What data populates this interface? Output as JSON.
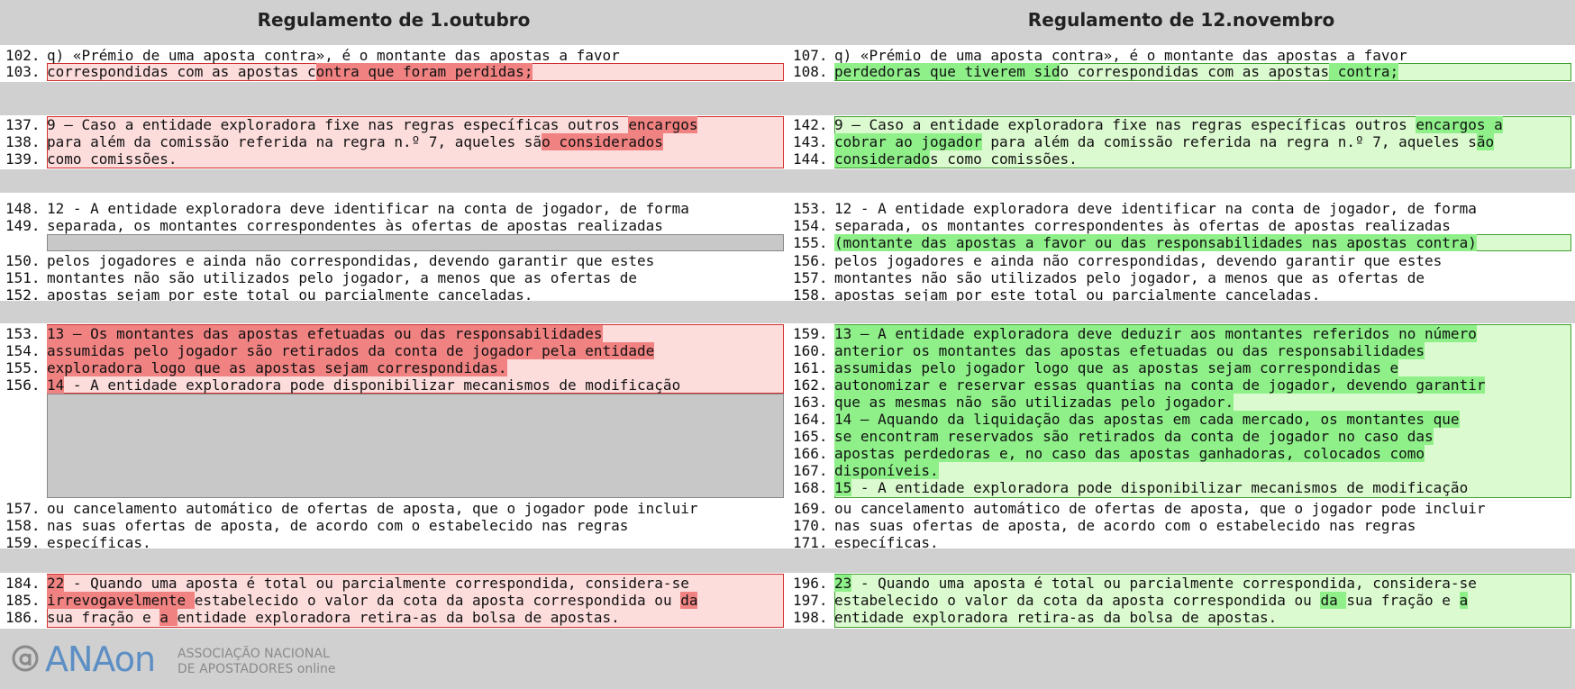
{
  "header": {
    "left_title": "Regulamento de 1.outubro",
    "right_title": "Regulamento de 12.novembro"
  },
  "hunks": [
    {
      "left": [
        {
          "n": "102.",
          "t": "q) «Prémio de uma aposta contra», é o montante das apostas a favor"
        },
        {
          "n": "103.",
          "t": "correspondidas com as apostas contra que foram perdidas;"
        }
      ],
      "right": [
        {
          "n": "107.",
          "t": "q) «Prémio de uma aposta contra», é o montante das apostas a favor"
        },
        {
          "n": "108.",
          "t": "perdedoras que tiverem sido correspondidas com as apostas contra;"
        }
      ]
    },
    {
      "left": [
        {
          "n": "137.",
          "t": "9 – Caso a entidade exploradora fixe nas regras específicas outros encargos"
        },
        {
          "n": "138.",
          "t": "para além da comissão referida na regra n.º 7, aqueles são considerados"
        },
        {
          "n": "139.",
          "t": "como comissões."
        }
      ],
      "right": [
        {
          "n": "142.",
          "t": "9 – Caso a entidade exploradora fixe nas regras específicas outros encargos a"
        },
        {
          "n": "143.",
          "t": "cobrar ao jogador para além da comissão referida na regra n.º 7, aqueles são"
        },
        {
          "n": "144.",
          "t": "considerados como comissões."
        }
      ]
    },
    {
      "left": [
        {
          "n": "148.",
          "t": "12 - A entidade exploradora deve identificar na conta de jogador, de forma"
        },
        {
          "n": "149.",
          "t": "separada, os montantes correspondentes às ofertas de apostas realizadas"
        },
        {
          "n": "150.",
          "t": "pelos jogadores e ainda não correspondidas, devendo garantir que estes"
        },
        {
          "n": "151.",
          "t": "montantes não são utilizados pelo jogador, a menos que as ofertas de"
        },
        {
          "n": "152.",
          "t": "apostas sejam por este total ou parcialmente canceladas."
        }
      ],
      "right": [
        {
          "n": "153.",
          "t": "12 - A entidade exploradora deve identificar na conta de jogador, de forma"
        },
        {
          "n": "154.",
          "t": "separada, os montantes correspondentes às ofertas de apostas realizadas"
        },
        {
          "n": "155.",
          "t": "(montante das apostas a favor ou das responsabilidades nas apostas contra)"
        },
        {
          "n": "156.",
          "t": "pelos jogadores e ainda não correspondidas, devendo garantir que estes"
        },
        {
          "n": "157.",
          "t": "montantes não são utilizados pelo jogador, a menos que as ofertas de"
        },
        {
          "n": "158.",
          "t": "apostas sejam por este total ou parcialmente canceladas."
        }
      ]
    },
    {
      "left": [
        {
          "n": "153.",
          "t": "13 – Os montantes das apostas efetuadas ou das responsabilidades"
        },
        {
          "n": "154.",
          "t": "assumidas pelo jogador são retirados da conta de jogador pela entidade"
        },
        {
          "n": "155.",
          "t": "exploradora logo que as apostas sejam correspondidas."
        },
        {
          "n": "156.",
          "t": "14 - A entidade exploradora pode disponibilizar mecanismos de modificação"
        },
        {
          "n": "157.",
          "t": "ou cancelamento automático de ofertas de aposta, que o jogador pode incluir"
        },
        {
          "n": "158.",
          "t": "nas suas ofertas de aposta, de acordo com o estabelecido nas regras"
        },
        {
          "n": "159.",
          "t": "específicas."
        }
      ],
      "right": [
        {
          "n": "159.",
          "t": "13 – A entidade exploradora deve deduzir aos montantes referidos no número"
        },
        {
          "n": "160.",
          "t": "anterior os montantes das apostas efetuadas ou das responsabilidades"
        },
        {
          "n": "161.",
          "t": "assumidas pelo jogador logo que as apostas sejam correspondidas e"
        },
        {
          "n": "162.",
          "t": "autonomizar e reservar essas quantias na conta de jogador, devendo garantir"
        },
        {
          "n": "163.",
          "t": "que as mesmas não são utilizadas pelo jogador."
        },
        {
          "n": "164.",
          "t": "14 – Aquando da liquidação das apostas em cada mercado, os montantes que"
        },
        {
          "n": "165.",
          "t": "se encontram reservados são retirados da conta de jogador no caso das"
        },
        {
          "n": "166.",
          "t": "apostas perdedoras e, no caso das apostas ganhadoras, colocados como"
        },
        {
          "n": "167.",
          "t": "disponíveis."
        },
        {
          "n": "168.",
          "t": "15 - A entidade exploradora pode disponibilizar mecanismos de modificação"
        },
        {
          "n": "169.",
          "t": "ou cancelamento automático de ofertas de aposta, que o jogador pode incluir"
        },
        {
          "n": "170.",
          "t": "nas suas ofertas de aposta, de acordo com o estabelecido nas regras"
        },
        {
          "n": "171.",
          "t": "específicas."
        }
      ]
    },
    {
      "left": [
        {
          "n": "184.",
          "t": "22 - Quando uma aposta é total ou parcialmente correspondida, considera-se"
        },
        {
          "n": "185.",
          "t": "irrevogavelmente estabelecido o valor da cota da aposta correspondida ou da"
        },
        {
          "n": "186.",
          "t": "sua fração e a entidade exploradora retira-as da bolsa de apostas."
        }
      ],
      "right": [
        {
          "n": "196.",
          "t": "23 - Quando uma aposta é total ou parcialmente correspondida, considera-se"
        },
        {
          "n": "197.",
          "t": "estabelecido o valor da cota da aposta correspondida ou da sua fração e a"
        },
        {
          "n": "198.",
          "t": "entidade exploradora retira-as da bolsa de apostas."
        }
      ]
    }
  ],
  "footer": {
    "logo_name": "ANAon",
    "logo_sub_1": "ASSOCIAÇÃO NACIONAL",
    "logo_sub_2": "DE APOSTADORES online"
  },
  "colors": {
    "removed_line": "#fddcdc",
    "removed_word": "#f08282",
    "added_line": "#dcfad0",
    "added_word": "#8ff08a",
    "brand": "#5d8fc4"
  }
}
